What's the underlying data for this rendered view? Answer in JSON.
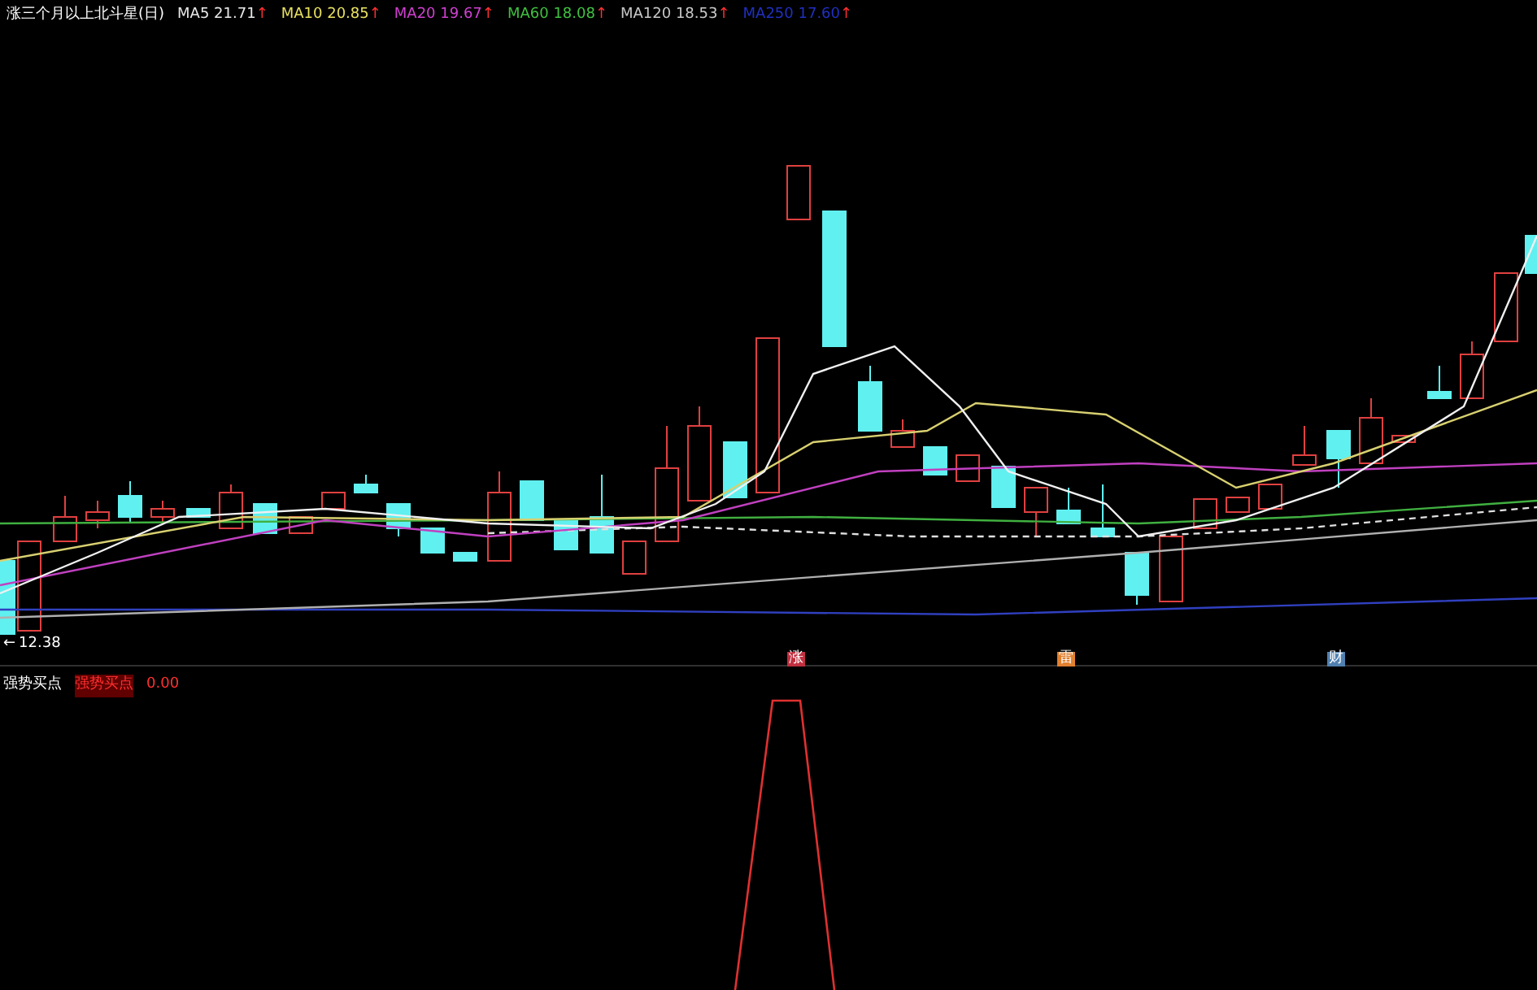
{
  "chart_title": "涨三个月以上北斗星(日)",
  "legend": [
    {
      "text": "MA5 21.71",
      "color": "#e8e8e8"
    },
    {
      "text": "MA10 20.85",
      "color": "#e8e060"
    },
    {
      "text": "MA20 19.67",
      "color": "#d040d0"
    },
    {
      "text": "MA60 18.08",
      "color": "#40c040"
    },
    {
      "text": "MA120 18.53",
      "color": "#c8c8c8"
    },
    {
      "text": "MA250 17.60",
      "color": "#2030c0"
    }
  ],
  "low_pointer": "←",
  "low_price": "12.38",
  "trend_arrow": "↑",
  "markers": [
    {
      "text": "涨",
      "color": "#c03040"
    },
    {
      "text": "雷",
      "color": "#e08030"
    },
    {
      "text": "财",
      "color": "#5080b0"
    }
  ],
  "indicator": {
    "name": "强势买点",
    "label": "强势买点",
    "value": "0.00"
  }
}
